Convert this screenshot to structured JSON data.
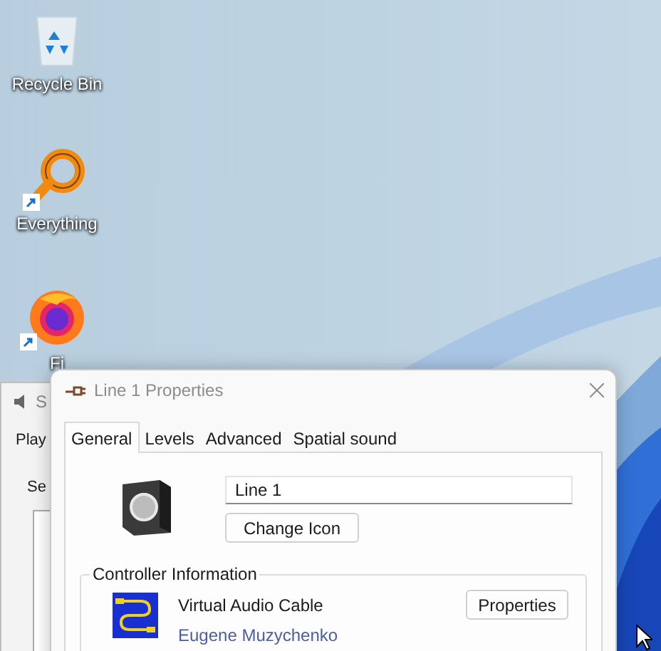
{
  "desktop": {
    "icons": [
      {
        "kind": "recycle",
        "label": "Recycle Bin",
        "shortcut": false
      },
      {
        "kind": "magnifier",
        "label": "Everything",
        "shortcut": true
      },
      {
        "kind": "browser",
        "label": "Fi",
        "shortcut": true
      }
    ]
  },
  "back_window": {
    "title": "S",
    "tab": "Play",
    "label": "Se"
  },
  "dialog": {
    "title": "Line 1 Properties",
    "tabs": [
      {
        "label": "General",
        "selected": true
      },
      {
        "label": "Levels",
        "selected": false
      },
      {
        "label": "Advanced",
        "selected": false
      },
      {
        "label": "Spatial sound",
        "selected": false
      }
    ],
    "name_field": {
      "value": "Line 1"
    },
    "change_icon_button": "Change Icon",
    "group": {
      "title": "Controller Information",
      "controller": "Virtual Audio Cable",
      "vendor_link": "Eugene Muzychenko",
      "properties_button": "Properties"
    }
  }
}
